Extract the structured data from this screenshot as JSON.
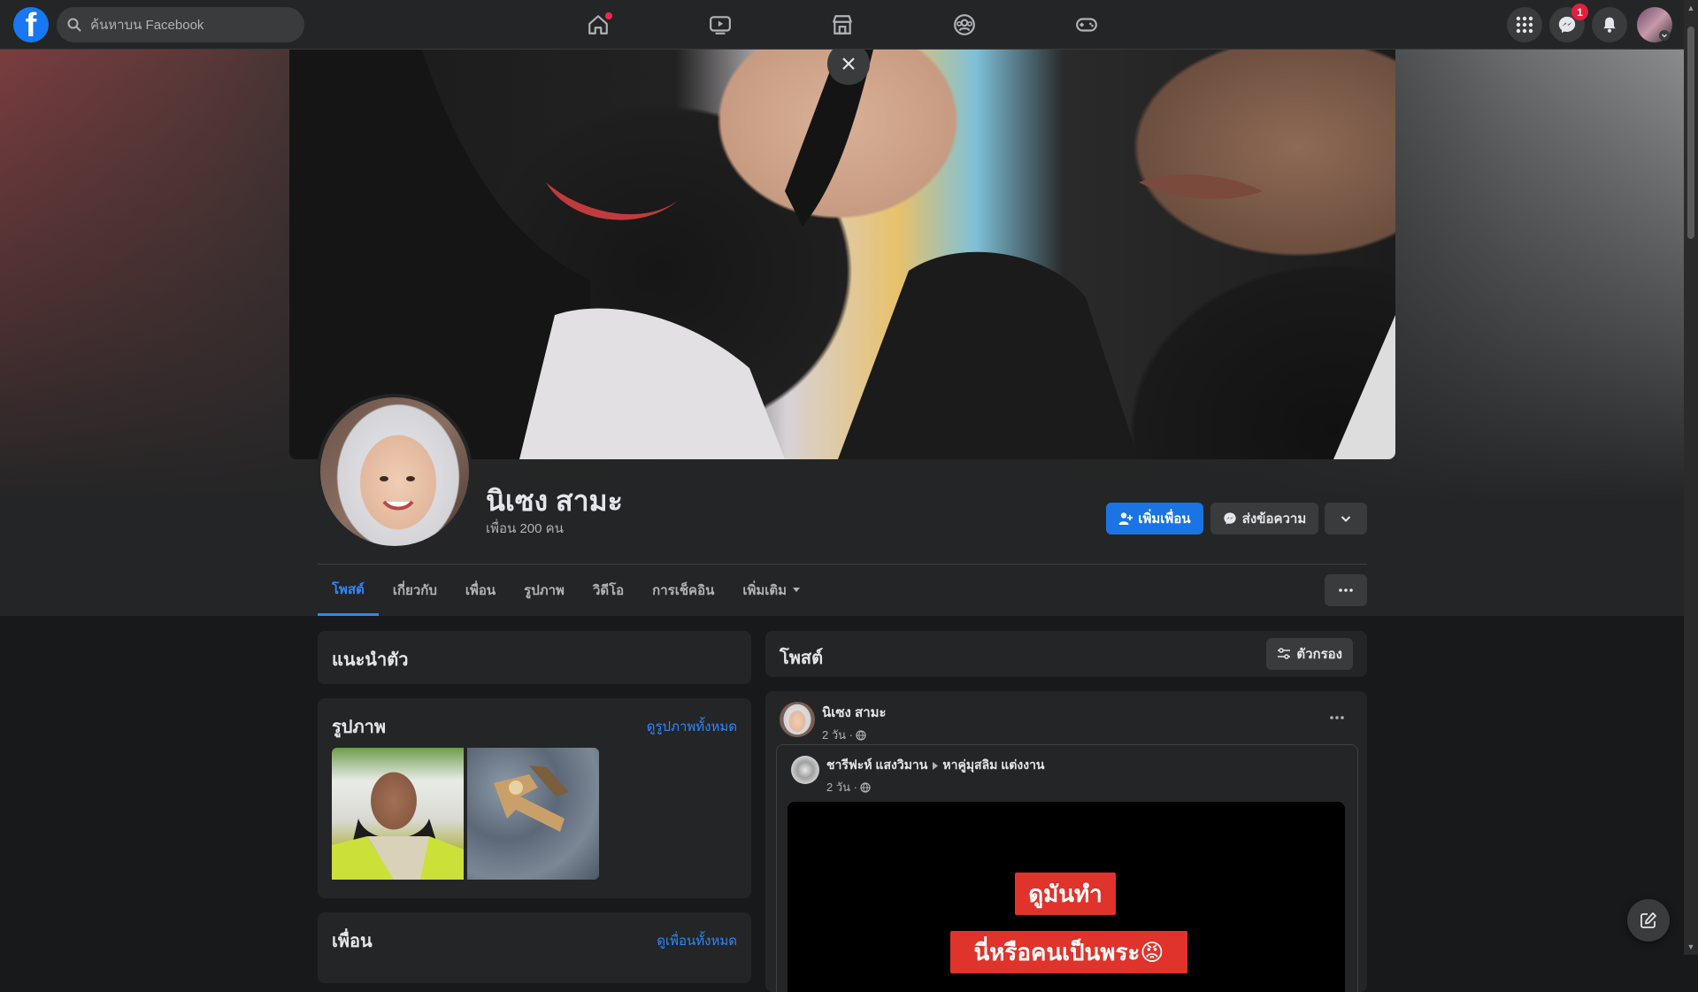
{
  "topbar": {
    "search_placeholder": "ค้นหาบน Facebook",
    "messenger_badge": "1"
  },
  "profile": {
    "name": "นิเซง สามะ",
    "friends": "เพื่อน 200 คน",
    "add_friend_label": "เพิ่มเพื่อน",
    "message_label": "ส่งข้อความ"
  },
  "tabs": [
    {
      "label": "โพสต์",
      "active": true
    },
    {
      "label": "เกี่ยวกับ"
    },
    {
      "label": "เพื่อน"
    },
    {
      "label": "รูปภาพ"
    },
    {
      "label": "วิดีโอ"
    },
    {
      "label": "การเช็คอิน"
    },
    {
      "label": "เพิ่มเติม"
    }
  ],
  "left": {
    "intro_title": "แนะนำตัว",
    "photos_title": "รูปภาพ",
    "photos_link": "ดูรูปภาพทั้งหมด",
    "friends_title": "เพื่อน",
    "friends_link": "ดูเพื่อนทั้งหมด"
  },
  "posts": {
    "title": "โพสต์",
    "filter_label": "ตัวกรอง",
    "post_author": "นิเซง สามะ",
    "post_time": "2 วัน ·",
    "shared_author": "ชารีฟะห์ แสงวิมาน",
    "shared_group": "หาคู่มุสลิม แต่งงาน",
    "shared_time": "2 วัน ·",
    "video_text_1": "ดูมันทำ",
    "video_text_2": "นี่หรือคนเป็นพระ😡"
  },
  "colors": {
    "primary": "#1b74e4",
    "link": "#2d88ff",
    "badge": "#e41e3f",
    "background": "#18191a",
    "surface": "#242526"
  }
}
